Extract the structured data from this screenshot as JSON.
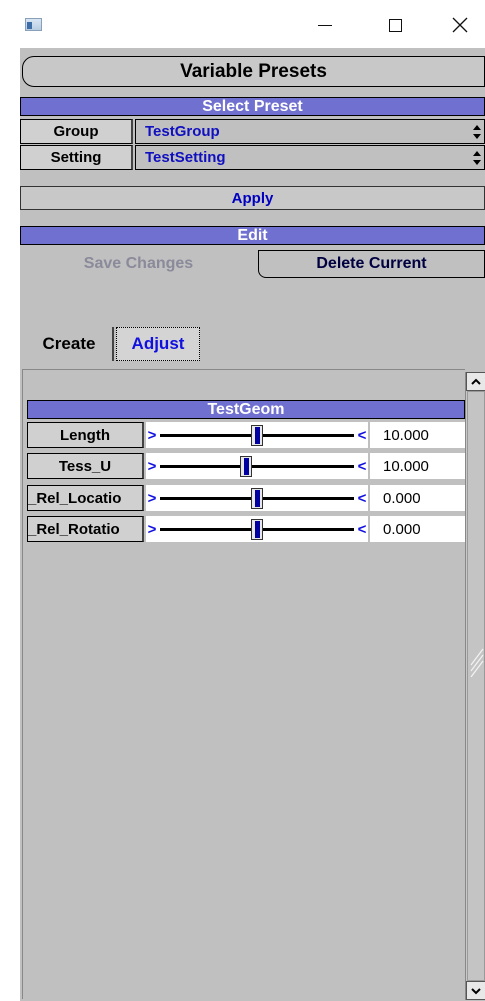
{
  "window": {
    "title": "",
    "controls": {
      "minimize_icon": "minimize-icon",
      "maximize_icon": "maximize-icon",
      "close_icon": "close-icon"
    }
  },
  "header": {
    "title": "Variable Presets"
  },
  "select_preset": {
    "section_title": "Select Preset",
    "group": {
      "label": "Group",
      "value": "TestGroup"
    },
    "setting": {
      "label": "Setting",
      "value": "TestSetting"
    },
    "apply_label": "Apply"
  },
  "edit": {
    "section_title": "Edit",
    "save_label": "Save Changes",
    "save_enabled": false,
    "delete_label": "Delete Current"
  },
  "tabs": [
    {
      "label": "Create",
      "active": false
    },
    {
      "label": "Adjust",
      "active": true
    }
  ],
  "geom": {
    "title": "TestGeom",
    "params": [
      {
        "label": "Length",
        "value": "10.000",
        "slider_fraction": 0.5
      },
      {
        "label": "Tess_U",
        "value": "10.000",
        "slider_fraction": 0.44
      },
      {
        "label": "_Rel_Locatio",
        "value": "0.000",
        "slider_fraction": 0.5
      },
      {
        "label": "_Rel_Rotatio",
        "value": "0.000",
        "slider_fraction": 0.5
      }
    ]
  },
  "colors": {
    "section_bar": "#7070d0",
    "accent_text": "#1010e0",
    "panel_bg": "#c0c0c0",
    "disabled_text": "#8a8a9a"
  }
}
